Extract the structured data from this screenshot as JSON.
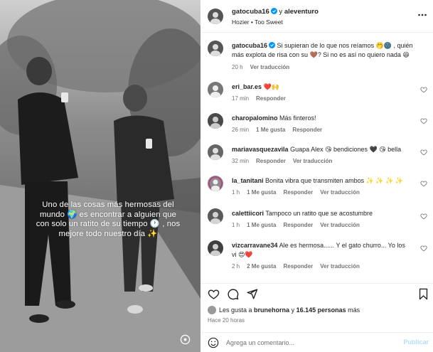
{
  "overlay": {
    "caption": "Uno de las cosas más hermosas del mundo 🌍 es encontrar a alguien que con solo un ratito de su tiempo 🕐 , nos mejore todo nuestro día ✨"
  },
  "header": {
    "user1": "gatocuba16",
    "joiner": " y ",
    "user2": "aleventuro",
    "song": "Hozier • Too Sweet"
  },
  "caption": {
    "user": "gatocuba16",
    "text": "Si supieran de lo que nos reíamos 🤭🌚 , quién más explota de risa con su 🤎? Si no es así no quiero nada 😆",
    "time": "20 h",
    "translate": "Ver traducción"
  },
  "comments": [
    {
      "user": "eri_bar.es",
      "text": "❤️🙌",
      "time": "17 min",
      "likes": "",
      "reply": "Responder",
      "translate": ""
    },
    {
      "user": "charopalomino",
      "text": "Más finteros!",
      "time": "26 min",
      "likes": "1 Me gusta",
      "reply": "Responder",
      "translate": ""
    },
    {
      "user": "mariavasquezavila",
      "text": "Guapa Alex 😘 bendiciones 🖤 😘 bella",
      "time": "32 min",
      "likes": "",
      "reply": "Responder",
      "translate": "Ver traducción"
    },
    {
      "user": "la_tanitani",
      "text": "Bonita vibra que transmiten ambos ✨ ✨ ✨ ✨",
      "time": "1 h",
      "likes": "1 Me gusta",
      "reply": "Responder",
      "translate": "Ver traducción"
    },
    {
      "user": "calettiicori",
      "text": "Tampoco un ratito que se acostumbre",
      "time": "1 h",
      "likes": "1 Me gusta",
      "reply": "Responder",
      "translate": "Ver traducción"
    },
    {
      "user": "vizcarravane34",
      "text": "Ale es hermosa...... Y el gato churro... Yo los vi 😍❤️",
      "time": "2 h",
      "likes": "2 Me gusta",
      "reply": "Responder",
      "translate": "Ver traducción"
    }
  ],
  "likes": {
    "prefix": "Les gusta a ",
    "user": "brunehorna",
    "mid": " y ",
    "count": "16.145 personas",
    "suffix": " más"
  },
  "time_ago": "Hace 20 horas",
  "add_comment": {
    "placeholder": "Agrega un comentario...",
    "publish": "Publicar"
  },
  "icons": [
    "heart-icon",
    "comment-icon",
    "share-icon",
    "bookmark-icon",
    "more-icon",
    "emoji-icon",
    "verified-icon",
    "reels-icon"
  ]
}
